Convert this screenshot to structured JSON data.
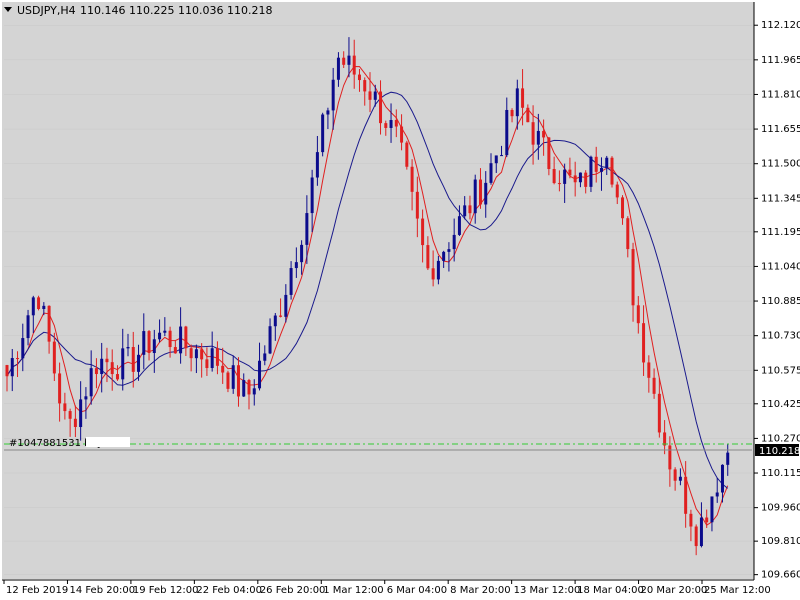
{
  "header": {
    "symbol": "USDJPY,H4",
    "ohlc": "110.146 110.225 110.036 110.218",
    "toggle_icon": "triangle-down-icon"
  },
  "order": {
    "label": "#1047881531 buy",
    "price": 110.245,
    "color": "#33cc33"
  },
  "current_price": {
    "label": "110.218",
    "value": 110.218,
    "color": "#000000"
  },
  "colors": {
    "background": "#d4d4d4",
    "bull": "#0b0b8c",
    "bear": "#e02020",
    "ma_fast": "#e02020",
    "ma_slow": "#1a1a8c",
    "tag_bg": "#000000"
  },
  "chart_data": {
    "type": "candlestick",
    "y_axis_ticks": [
      "112.120",
      "111.965",
      "111.810",
      "111.655",
      "111.500",
      "111.345",
      "111.195",
      "111.040",
      "110.885",
      "110.730",
      "110.575",
      "110.425",
      "110.270",
      "110.115",
      "109.960",
      "109.810",
      "109.660"
    ],
    "ylim": [
      109.645,
      112.215
    ],
    "x_axis_ticks": [
      "12 Feb 2019",
      "14 Feb 20:00",
      "19 Feb 12:00",
      "22 Feb 04:00",
      "26 Feb 20:00",
      "1 Mar 12:00",
      "6 Mar 04:00",
      "8 Mar 20:00",
      "13 Mar 12:00",
      "18 Mar 04:00",
      "20 Mar 20:00",
      "25 Mar 12:00"
    ],
    "key_closes": [
      110.55,
      110.95,
      110.3,
      110.62,
      110.6,
      110.74,
      110.68,
      110.62,
      110.45,
      110.82,
      111.3,
      111.98,
      111.85,
      111.6,
      111.02,
      111.22,
      111.45,
      111.78,
      111.52,
      111.38,
      111.6,
      110.8,
      110.2,
      109.85,
      110.22
    ],
    "candle_count": 138
  }
}
